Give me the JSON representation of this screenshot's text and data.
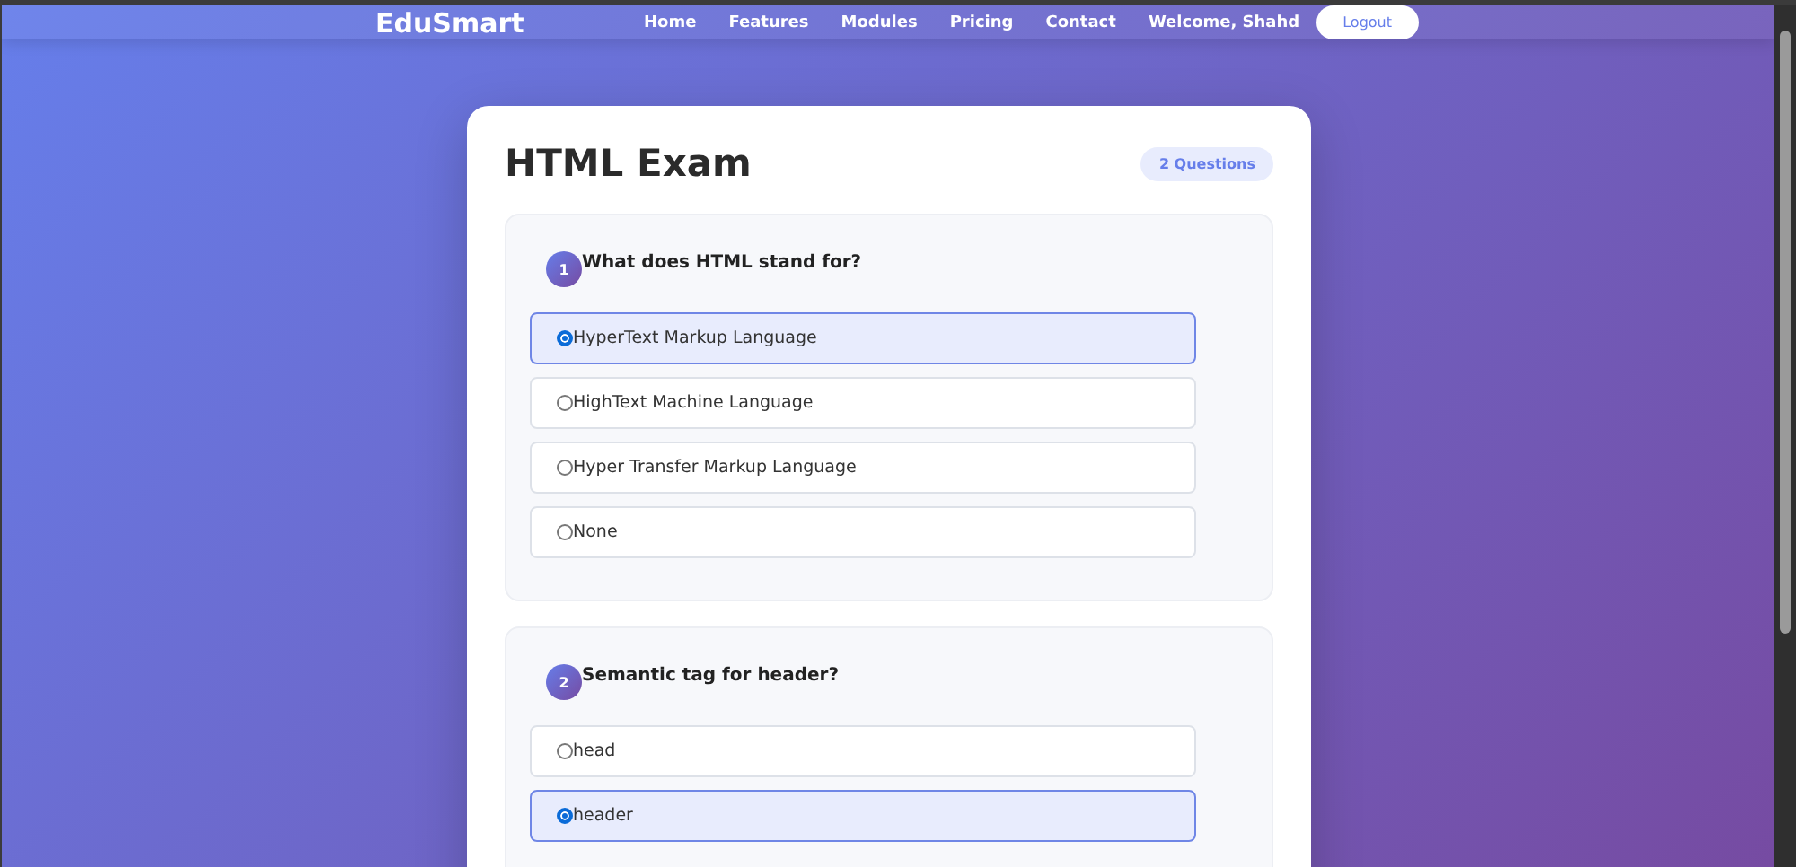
{
  "nav": {
    "brand": "EduSmart",
    "links": [
      "Home",
      "Features",
      "Modules",
      "Pricing",
      "Contact"
    ],
    "welcome": "Welcome, Shahd",
    "logout": "Logout"
  },
  "exam": {
    "title": "HTML Exam",
    "count": "2 Questions",
    "questions": [
      {
        "number": "1",
        "text": "What does HTML stand for?",
        "options": [
          {
            "label": "HyperText Markup Language",
            "selected": true
          },
          {
            "label": "HighText Machine Language",
            "selected": false
          },
          {
            "label": "Hyper Transfer Markup Language",
            "selected": false
          },
          {
            "label": "None",
            "selected": false
          }
        ]
      },
      {
        "number": "2",
        "text": "Semantic tag for header?",
        "options": [
          {
            "label": "head",
            "selected": false
          },
          {
            "label": "header",
            "selected": true
          }
        ]
      }
    ]
  }
}
